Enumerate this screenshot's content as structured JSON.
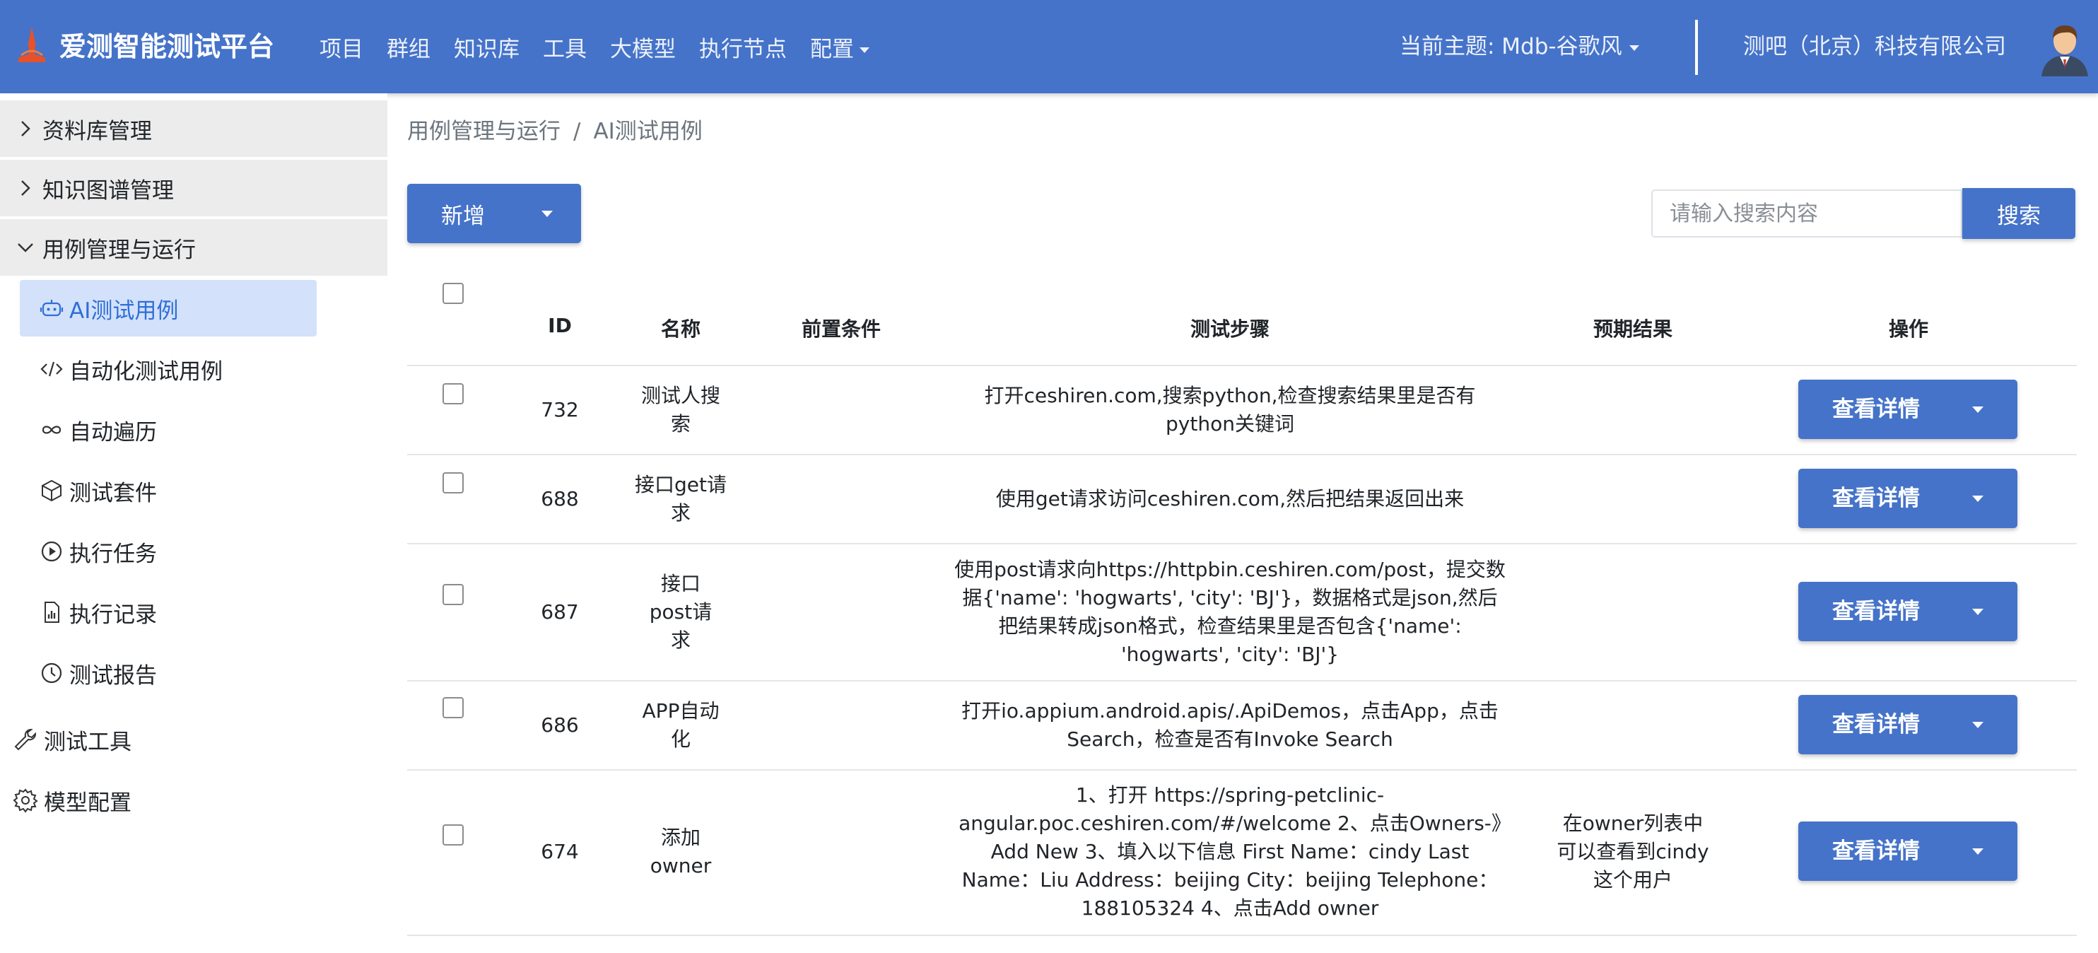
{
  "app": {
    "brand": "爱测智能测试平台",
    "nav": [
      "项目",
      "群组",
      "知识库",
      "工具",
      "大模型",
      "执行节点",
      "配置"
    ],
    "theme_label": "当前主题: Mdb-谷歌风",
    "company": "测吧（北京）科技有限公司",
    "accent_color": "#4573c9"
  },
  "sidebar": {
    "groups": [
      {
        "label": "资料库管理",
        "icon": "chevron-right-icon"
      },
      {
        "label": "知识图谱管理",
        "icon": "chevron-right-icon"
      },
      {
        "label": "用例管理与运行",
        "icon": "chevron-down-icon"
      }
    ],
    "subitems": [
      {
        "label": "AI测试用例",
        "icon": "robot-icon",
        "active": true
      },
      {
        "label": "自动化测试用例",
        "icon": "code-icon"
      },
      {
        "label": "自动遍历",
        "icon": "infinity-icon"
      },
      {
        "label": "测试套件",
        "icon": "box-icon"
      },
      {
        "label": "执行任务",
        "icon": "play-circle-icon"
      },
      {
        "label": "执行记录",
        "icon": "bar-chart-file-icon"
      },
      {
        "label": "测试报告",
        "icon": "clock-icon"
      }
    ],
    "top_items": [
      {
        "label": "测试工具",
        "icon": "wrench-icon"
      },
      {
        "label": "模型配置",
        "icon": "gear-icon"
      }
    ]
  },
  "breadcrumb": {
    "parent": "用例管理与运行",
    "separator": "/",
    "current": "AI测试用例"
  },
  "toolbar": {
    "add_label": "新增",
    "search_placeholder": "请输入搜索内容",
    "search_label": "搜索"
  },
  "table": {
    "headers": {
      "id": "ID",
      "name": "名称",
      "precondition": "前置条件",
      "steps": "测试步骤",
      "expected": "预期结果",
      "actions": "操作"
    },
    "action_label": "查看详情",
    "rows": [
      {
        "id": "732",
        "name": "测试人搜索",
        "precondition": "",
        "steps": "打开ceshiren.com,搜索python,检查搜索结果里是否有python关键词",
        "expected": ""
      },
      {
        "id": "688",
        "name": "接口get请求",
        "precondition": "",
        "steps": "使用get请求访问ceshiren.com,然后把结果返回出来",
        "expected": ""
      },
      {
        "id": "687",
        "name": "接口post请求",
        "precondition": "",
        "steps": "使用post请求向https://httpbin.ceshiren.com/post，提交数据{'name': 'hogwarts', 'city': 'BJ'}，数据格式是json,然后把结果转成json格式，检查结果里是否包含{'name': 'hogwarts', 'city': 'BJ'}",
        "expected": ""
      },
      {
        "id": "686",
        "name": "APP自动化",
        "precondition": "",
        "steps": "打开io.appium.android.apis/.ApiDemos，点击App，点击Search，检查是否有Invoke Search",
        "expected": ""
      },
      {
        "id": "674",
        "name": "添加owner",
        "precondition": "",
        "steps": "1、打开 https://spring-petclinic-angular.poc.ceshiren.com/#/welcome 2、点击Owners-》Add New 3、填入以下信息 First Name：cindy Last Name：Liu Address：beijing City：beijing Telephone：188105324 4、点击Add owner",
        "expected": "在owner列表中可以查看到cindy这个用户"
      }
    ]
  }
}
